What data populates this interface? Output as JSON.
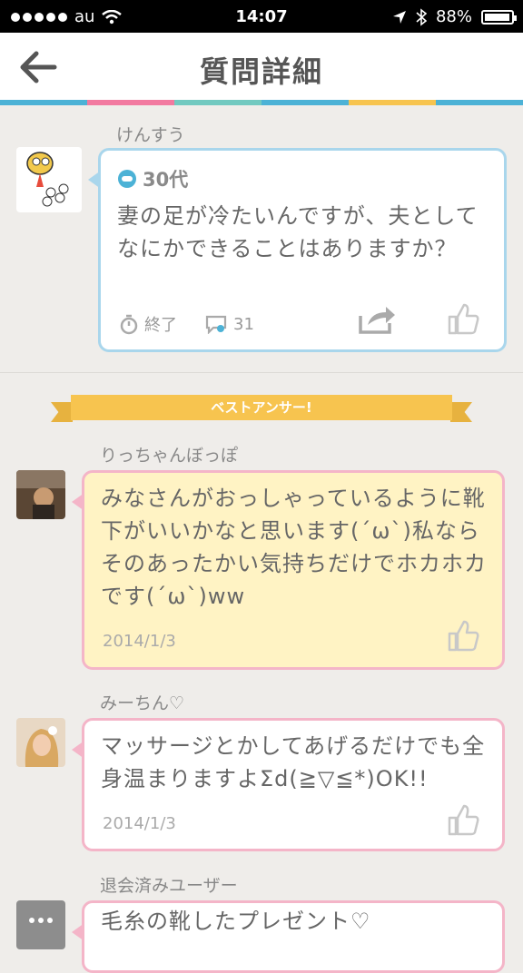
{
  "status": {
    "carrier": "au",
    "time": "14:07",
    "battery": "88%",
    "battery_level": 0.88
  },
  "nav": {
    "title": "質問詳細"
  },
  "question": {
    "user": "けんすう",
    "age": "30代",
    "text": "妻の足が冷たいんですが、夫としてなにかできることはありますか？",
    "status": "終了",
    "comments": "31"
  },
  "best_label": "ベストアンサー!",
  "answers": [
    {
      "user": "りっちゃんぼっぽ",
      "text": "みなさんがおっしゃっているように靴下がいいかなと思います(´ω`)私ならそのあったかい気持ちだけでホカホカです(´ω`)ww",
      "date": "2014/1/3"
    },
    {
      "user": "みーちん♡",
      "text": "マッサージとかしてあげるだけでも全身温まりますよΣd(≧▽≦*)OK!!",
      "date": "2014/1/3"
    },
    {
      "user": "退会済みユーザー",
      "text": "毛糸の靴したプレゼント♡"
    }
  ],
  "colors": {
    "accent_blue": "#a9d6ec",
    "accent_pink": "#f4b5c8",
    "best_bg": "#fff3c4",
    "ribbon": "#f7c44f"
  }
}
